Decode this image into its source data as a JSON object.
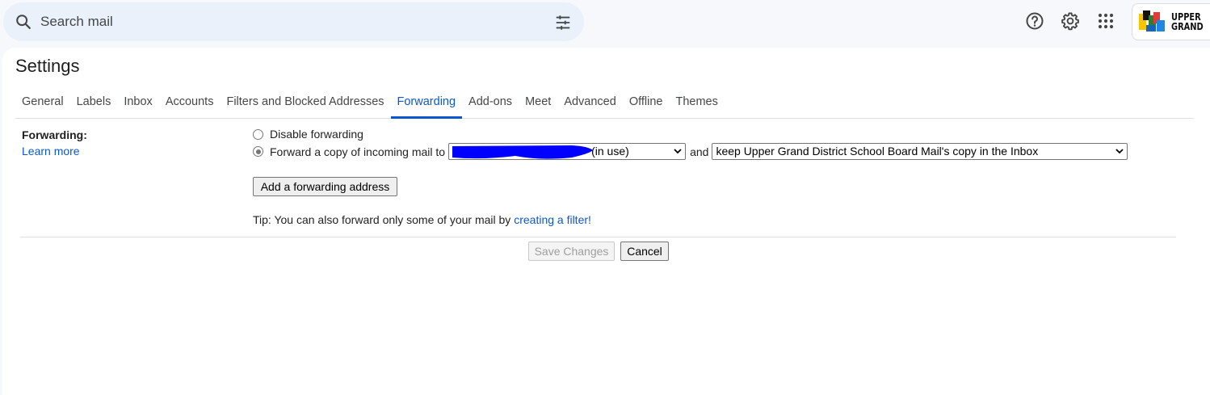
{
  "search": {
    "placeholder": "Search mail"
  },
  "account": {
    "org_logo_line1": "UPPER",
    "org_logo_line2": "GRAND"
  },
  "settings": {
    "title": "Settings",
    "tabs": [
      {
        "label": "General"
      },
      {
        "label": "Labels"
      },
      {
        "label": "Inbox"
      },
      {
        "label": "Accounts"
      },
      {
        "label": "Filters and Blocked Addresses"
      },
      {
        "label": "Forwarding",
        "active": true
      },
      {
        "label": "Add-ons"
      },
      {
        "label": "Meet"
      },
      {
        "label": "Advanced"
      },
      {
        "label": "Offline"
      },
      {
        "label": "Themes"
      }
    ],
    "forwarding": {
      "label": "Forwarding:",
      "learn_more": "Learn more",
      "disable_option": "Disable forwarding",
      "forward_option": "Forward a copy of incoming mail to",
      "selected_option": "forward",
      "address_select_visible_suffix": "(in use)",
      "and_text": "and",
      "keep_select_value": "keep Upper Grand District School Board Mail's copy in the Inbox",
      "add_address_button": "Add a forwarding address",
      "tip_text": "Tip: You can also forward only some of your mail by ",
      "tip_link": "creating a filter!"
    },
    "actions": {
      "save_label": "Save Changes",
      "save_enabled": false,
      "cancel_label": "Cancel"
    }
  },
  "colors": {
    "accent": "#0b57d0",
    "search_bg": "#eaf1fb",
    "page_bg": "#f6f8fc",
    "redaction": "#0000ff"
  },
  "icons": [
    "search-icon",
    "tune-icon",
    "help-icon",
    "gear-icon",
    "apps-icon",
    "chevron-down-icon"
  ]
}
